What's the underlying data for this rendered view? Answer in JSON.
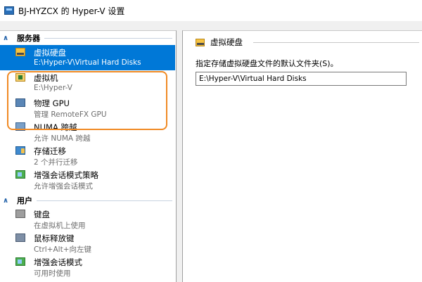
{
  "window": {
    "title": "BJ-HYZCX 的 Hyper-V 设置"
  },
  "sidebar": {
    "server_header": "服务器",
    "user_header": "用户",
    "items": [
      {
        "label": "虚拟硬盘",
        "sub": "E:\\Hyper-V\\Virtual Hard Disks",
        "icon": "virtual-disk-icon",
        "selected": true
      },
      {
        "label": "虚拟机",
        "sub": "E:\\Hyper-V",
        "icon": "virtual-machine-folder-icon"
      },
      {
        "label": "物理 GPU",
        "sub": "管理 RemoteFX GPU",
        "icon": "gpu-icon"
      },
      {
        "label": "NUMA 跨越",
        "sub": "允许 NUMA 跨越",
        "icon": "numa-icon"
      },
      {
        "label": "存储迁移",
        "sub": "2 个并行迁移",
        "icon": "storage-migration-icon"
      },
      {
        "label": "增强会话模式策略",
        "sub": "允许增强会话模式",
        "icon": "enhanced-session-policy-icon"
      }
    ],
    "user_items": [
      {
        "label": "键盘",
        "sub": "在虚拟机上使用",
        "icon": "keyboard-icon"
      },
      {
        "label": "鼠标释放键",
        "sub": "Ctrl+Alt+向左键",
        "icon": "mouse-release-icon"
      },
      {
        "label": "增强会话模式",
        "sub": "可用时使用",
        "icon": "enhanced-session-icon"
      }
    ]
  },
  "main": {
    "group_title": "虚拟硬盘",
    "description": "指定存储虚拟硬盘文件的默认文件夹(S)。",
    "path_value": "E:\\Hyper-V\\Virtual Hard Disks"
  },
  "colors": {
    "selection": "#0078d7",
    "highlight": "#f08a24"
  }
}
